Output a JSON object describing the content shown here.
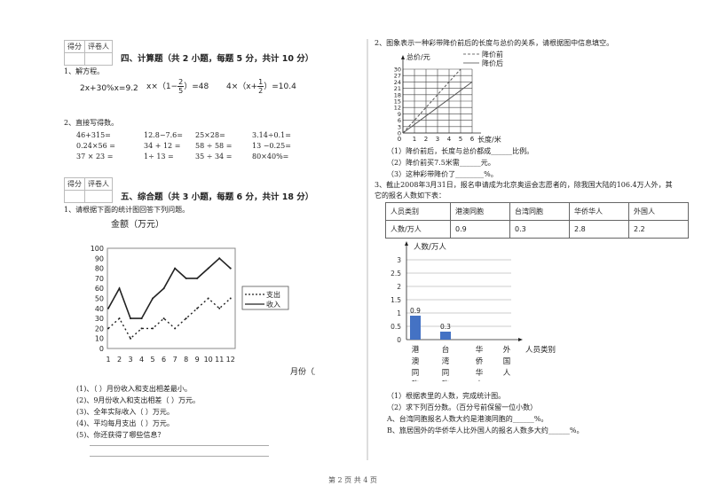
{
  "footer": {
    "page": "第 2 页 共 4 页"
  },
  "score_box": {
    "col1": "得分",
    "col2": "评卷人"
  },
  "section4": {
    "title": "四、计算题（共 2 小题，每题 5 分，共计 10 分）",
    "q1": {
      "label": "1、解方程。",
      "eq1": "2x+30%x=9.2",
      "eq2_pre": "x×（1−",
      "eq2_num": "2",
      "eq2_den": "5",
      "eq2_post": "）=48",
      "eq3_pre": "4×（x+",
      "eq3_num": "1",
      "eq3_den": "2",
      "eq3_post": "）=10.4"
    },
    "q2": {
      "label": "2、直接写得数。",
      "rows": [
        [
          "46+315=",
          "12.8−7.6=",
          "25×28=",
          "3.14÷0.1="
        ],
        [
          "0.24×56 =",
          "34 + 12 =",
          "58 ÷ 58 =",
          "13 −0.25="
        ],
        [
          "37 × 23 =",
          "1÷ 13 =",
          "35 ÷ 34 =",
          "80×40%="
        ]
      ]
    }
  },
  "section5": {
    "title": "五、综合题（共 3 小题，每题 6 分，共计 18 分）",
    "q1": {
      "label": "1、请根据下面的统计图回答下列问题。",
      "questions": [
        "(1)、（ ）月份收入和支出相差最小。",
        "(2)、9月份收入和支出相差（ ）万元。",
        "(3)、全年实际收入（ ）万元。",
        "(4)、平均每月支出（ ）万元。",
        "(5)、你还获得了哪些信息？"
      ]
    },
    "q2": {
      "label": "2、图象表示一种彩带降价前后的长度与总价的关系，请根据图中信息填空。",
      "questions": [
        "（1）降价前后，长度与总价都成______比例。",
        "（2）降价前买7.5米需______元。",
        "（3）这种彩带降价了________%。"
      ]
    },
    "q3": {
      "label_line1": "3、截止2008年3月31日，报名申请成为北京奥运会志愿者的，除我国大陆的106.4万人外，其",
      "label_line2": "它的报名人数如下表：",
      "table": {
        "header": [
          "人员类别",
          "港澳同胞",
          "台湾同胞",
          "华侨华人",
          "外国人"
        ],
        "row": [
          "人数/万人",
          "0.9",
          "0.3",
          "2.8",
          "2.2"
        ]
      },
      "questions": [
        "（1）根据表里的人数，完成统计图。",
        "（2）求下列百分数。（百分号前保留一位小数）",
        "A、台湾同胞报名人数大约是港澳同胞的______%。",
        "B、旅居国外的华侨华人比外国人的报名人数多大约______%。"
      ]
    }
  },
  "chart_data": [
    {
      "type": "line",
      "title": "金额（万元）",
      "xlabel": "月份（月）",
      "ylabel": "金额（万元）",
      "x": [
        1,
        2,
        3,
        4,
        5,
        6,
        7,
        8,
        9,
        10,
        11,
        12
      ],
      "ylim": [
        0,
        100
      ],
      "yticks": [
        0,
        10,
        20,
        30,
        40,
        50,
        60,
        70,
        80,
        90,
        100
      ],
      "legend_position": "right",
      "series": [
        {
          "name": "支出",
          "style": "dashed",
          "values": [
            20,
            30,
            10,
            20,
            20,
            30,
            20,
            30,
            40,
            50,
            40,
            50
          ]
        },
        {
          "name": "收入",
          "style": "solid",
          "values": [
            40,
            60,
            30,
            30,
            50,
            60,
            80,
            70,
            70,
            80,
            90,
            80
          ]
        }
      ]
    },
    {
      "type": "line",
      "title": "",
      "xlabel": "长度/米",
      "ylabel": "总价/元",
      "x": [
        0,
        1,
        2,
        3,
        4,
        5,
        6
      ],
      "xlim": [
        0,
        6
      ],
      "ylim": [
        0,
        30
      ],
      "yticks": [
        0,
        3,
        6,
        9,
        12,
        15,
        18,
        21,
        24,
        27,
        30
      ],
      "xticks": [
        1,
        2,
        3,
        4,
        5,
        6
      ],
      "grid": true,
      "legend_position": "top-right",
      "series": [
        {
          "name": "降价前",
          "style": "dashed",
          "points": [
            [
              0,
              0
            ],
            [
              5,
              30
            ]
          ]
        },
        {
          "name": "降价后",
          "style": "solid",
          "points": [
            [
              0,
              0
            ],
            [
              6,
              24
            ]
          ]
        }
      ]
    },
    {
      "type": "bar",
      "title": "",
      "xlabel": "人员类别",
      "ylabel": "人数/万人",
      "categories": [
        "港澳同胞",
        "台湾同胞",
        "华侨华人",
        "外国人"
      ],
      "values": [
        0.9,
        0.3,
        null,
        null
      ],
      "data_labels": [
        "0.9",
        "0.3",
        "",
        ""
      ],
      "ylim": [
        0,
        3
      ],
      "yticks": [
        "0",
        "0.5",
        "1",
        "1.5",
        "2",
        "2.5",
        "3"
      ],
      "grid": true,
      "bar_color": "#4472c4"
    }
  ]
}
